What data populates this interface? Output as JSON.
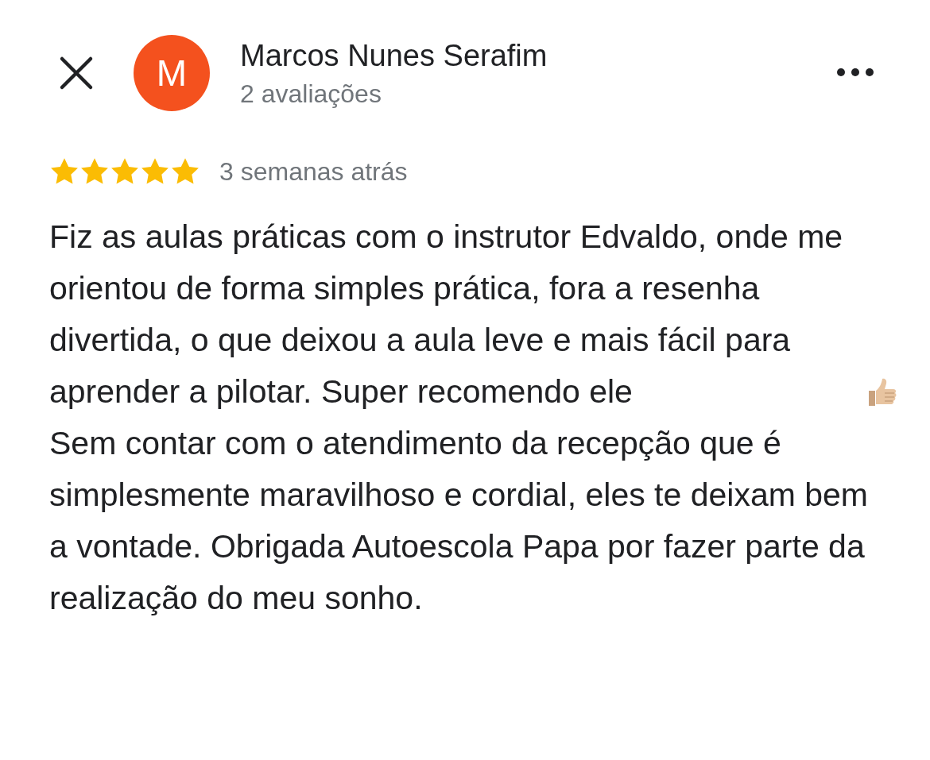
{
  "header": {
    "avatar_letter": "M",
    "author": "Marcos Nunes Serafim",
    "review_count": "2 avaliações"
  },
  "review": {
    "stars": 5,
    "time": "3 semanas atrás",
    "paragraphs": [
      "Fiz as aulas práticas com o instrutor Edvaldo, onde me orientou de forma simples prática, fora a resenha divertida, o que deixou a aula leve e mais fácil para aprender a pilotar. Super recomendo ele",
      "Sem contar com o atendimento da recepção que é simplesmente maravilhoso e cordial, eles te deixam bem a vontade. Obrigada Autoescola Papa por fazer parte da realização do meu sonho."
    ]
  }
}
